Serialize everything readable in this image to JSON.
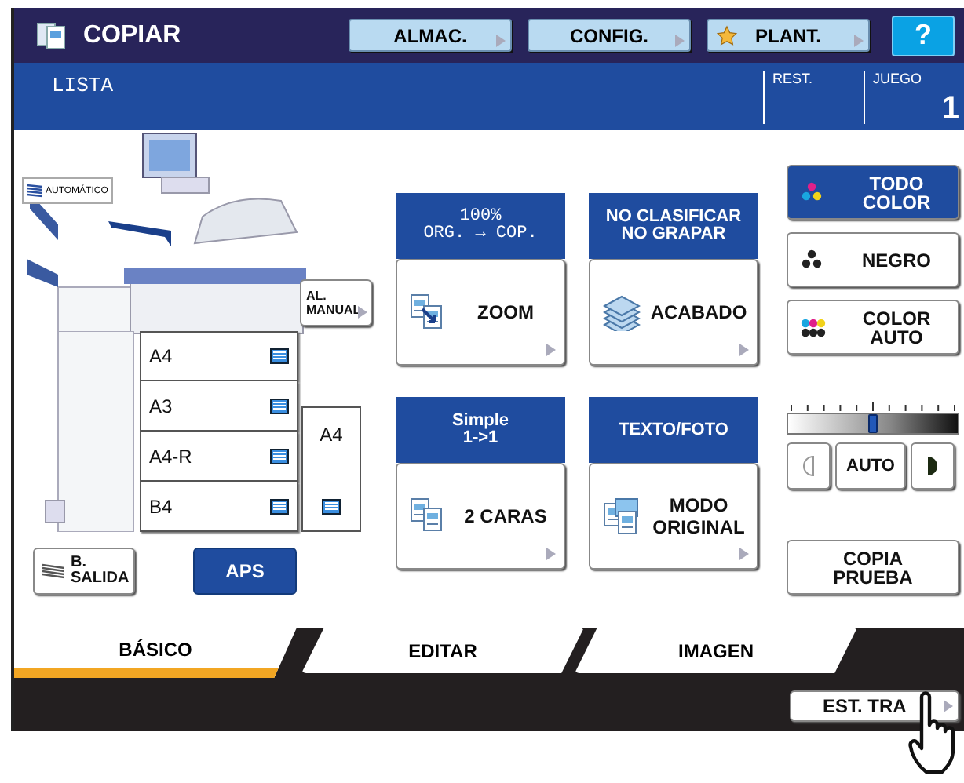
{
  "header": {
    "title": "COPIAR",
    "buttons": [
      {
        "label": "ALMAC.",
        "kind": "plain"
      },
      {
        "label": "CONFIG.",
        "kind": "plain"
      },
      {
        "label": "PLANT.",
        "kind": "star"
      }
    ],
    "help": "?"
  },
  "status": {
    "message": "LISTA",
    "remaining_label": "REST.",
    "sets_label": "JUEGO",
    "sets": "1"
  },
  "machine": {
    "output_label": "AUTOMÁTICO",
    "bypass_button": "AL.\nMANUAL",
    "trays": [
      {
        "size": "A4",
        "selected": false
      },
      {
        "size": "A3",
        "selected": false
      },
      {
        "size": "A4-R",
        "selected": false
      },
      {
        "size": "B4",
        "selected": false
      }
    ],
    "bypass": {
      "size": "A4",
      "selected": false
    },
    "exit_button": "B.\nSALIDA",
    "aps": {
      "label": "APS",
      "selected": true
    }
  },
  "functions": [
    {
      "status": "100%\nORG. → COP.",
      "label": "ZOOM"
    },
    {
      "status": "NO CLASIFICAR\nNO GRAPAR",
      "label": "ACABADO"
    },
    {
      "status": "Simple\n1->1",
      "label": "2 CARAS"
    },
    {
      "status": "TEXTO/FOTO",
      "label": "MODO\nORIGINAL"
    }
  ],
  "color_modes": [
    {
      "label": "TODO\nCOLOR",
      "selected": true
    },
    {
      "label": "NEGRO",
      "selected": false
    },
    {
      "label": "COLOR\nAUTO",
      "selected": false
    }
  ],
  "density": {
    "level": 0.5,
    "auto_label": "AUTO"
  },
  "proof_button": "COPIA\nPRUEBA",
  "tabs": [
    {
      "label": "BÁSICO",
      "selected": true
    },
    {
      "label": "EDITAR",
      "selected": false
    },
    {
      "label": "IMAGEN",
      "selected": false
    }
  ],
  "footer_button": "EST. TRA"
}
